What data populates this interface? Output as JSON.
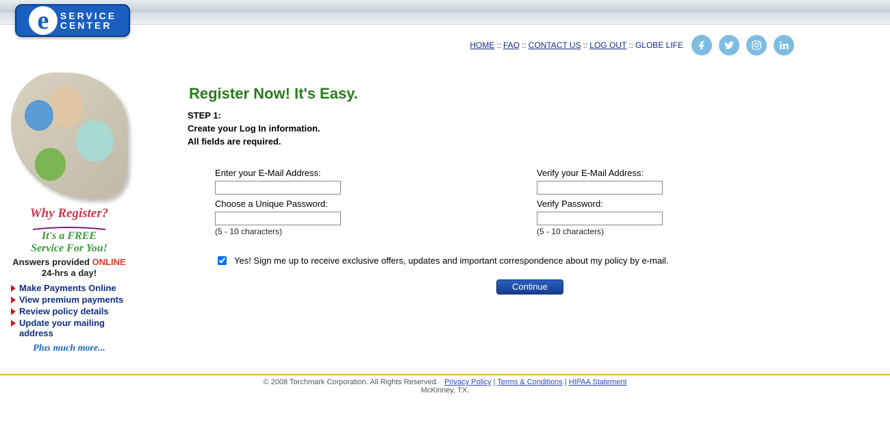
{
  "logo": {
    "e": "e",
    "line1": "SERVICE",
    "line2": "CENTER"
  },
  "nav": {
    "home": "HOME",
    "faq": "FAQ",
    "contact": "CONTACT US",
    "logout": "LOG OUT",
    "globe": "GLOBE LIFE",
    "sep": ":: "
  },
  "social": {
    "facebook": "facebook-icon",
    "twitter": "twitter-icon",
    "instagram": "instagram-icon",
    "linkedin": "linkedin-icon"
  },
  "sidebar": {
    "why_title": "Why Register?",
    "free_line1": "It's a FREE",
    "free_line2": "Service For You!",
    "answers_prefix": "Answers provided ",
    "answers_online": "ONLINE",
    "answers_suffix": "24-hrs a day!",
    "features": [
      "Make Payments Online",
      "View premium payments",
      "Review policy details",
      "Update your mailing address"
    ],
    "plus_more": "Plus much more..."
  },
  "main": {
    "title": "Register Now! It's Easy.",
    "step1": "STEP 1:",
    "step1_line2": "Create your Log In information.",
    "step1_line3": "All fields are required.",
    "email_label": "Enter your E-Mail Address:",
    "email_verify_label": "Verify your E-Mail Address:",
    "pw_label": "Choose a Unique Password:",
    "pw_verify_label": "Verify Password:",
    "pw_hint": "(5 - 10 characters)",
    "optin_text": "Yes! Sign me up to receive exclusive offers, updates and important correspondence about my policy by e-mail.",
    "continue": "Continue"
  },
  "footer": {
    "copyright": "© 2008 Torchmark Corporation. All Rights Reserved.",
    "privacy": "Privacy Policy",
    "terms": "Terms & Conditions",
    "hipaa": "HIPAA Statement",
    "city": "McKinney, TX.",
    "pipe": " | "
  }
}
